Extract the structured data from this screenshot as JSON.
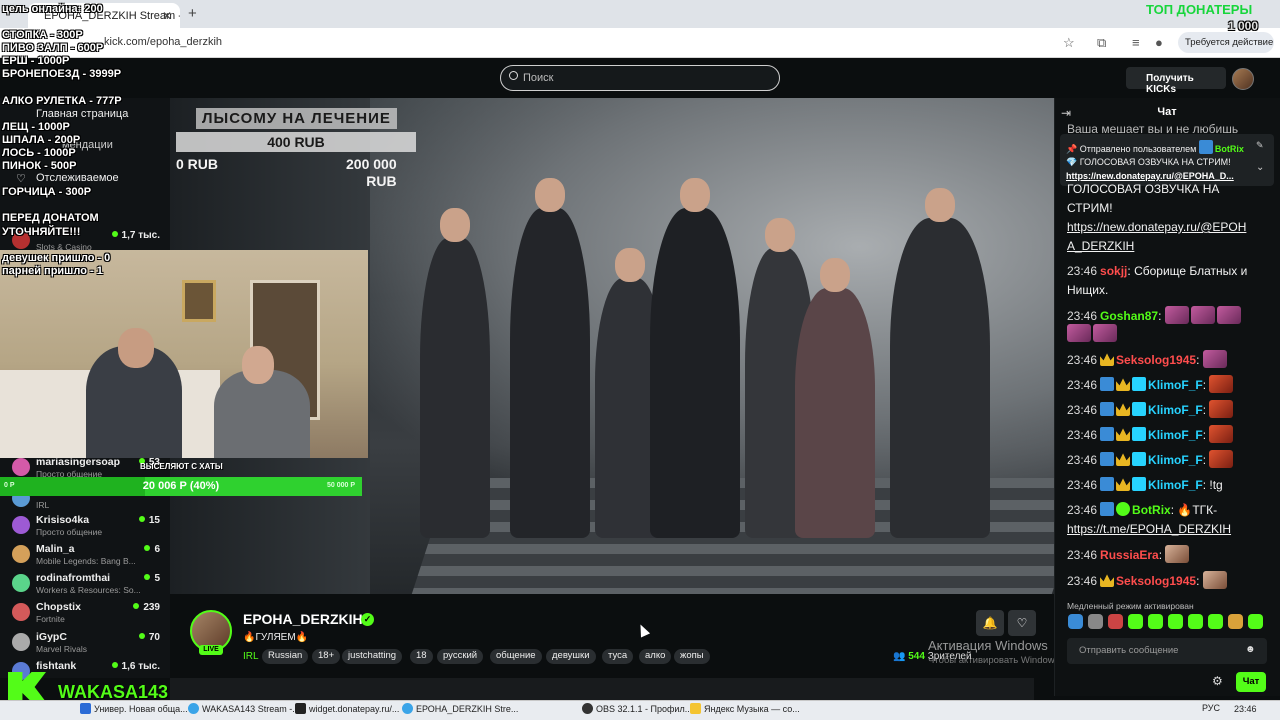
{
  "browser": {
    "tab_title": "ЕРОНА_DERZKIH Stream - ",
    "url": "kick.com/epoha_derzkih",
    "update_chip": "Требуется действие"
  },
  "header": {
    "search_placeholder": "Поиск",
    "get_kicks": "Получить KICKs"
  },
  "sidebar": {
    "home": "Главная страница",
    "following": "Отслеживаемое",
    "featured_visible": "мендации",
    "channels": [
      {
        "name": "",
        "category": "Slots & Casino",
        "viewers": "1,7 тыс.",
        "color": "#b53030"
      },
      {
        "name": "mariasingersoap",
        "category": "Просто общение",
        "viewers": "53",
        "color": "#d45aa8"
      },
      {
        "name": "",
        "category": "IRL",
        "viewers": "",
        "color": "#5a9ad4"
      },
      {
        "name": "Krisiso4ka",
        "category": "Просто общение",
        "viewers": "15",
        "color": "#9d5ad4"
      },
      {
        "name": "Malin_a",
        "category": "Mobile Legends: Bang B...",
        "viewers": "6",
        "color": "#d4a05a"
      },
      {
        "name": "rodinafromthai",
        "category": "Workers & Resources: So...",
        "viewers": "5",
        "color": "#5ad48a"
      },
      {
        "name": "Chopstix",
        "category": "Fortnite",
        "viewers": "239",
        "color": "#d45a5a"
      },
      {
        "name": "iGypC",
        "category": "Marvel Rivals",
        "viewers": "70",
        "color": "#aaaaaa"
      },
      {
        "name": "fishtank",
        "category": "",
        "viewers": "1,6 тыс.",
        "color": "#5a7ad4"
      }
    ]
  },
  "overlay": {
    "goal_online": "цель онлайна: 200",
    "price_list": [
      "СТОПКА - 300Р",
      "ПИВО ЗАЛП - 600Р",
      "ЕРШ - 1000Р",
      "БРОНЕПОЕЗД - 3999Р",
      "АЛКО РУЛЕТКА - 777Р",
      "ЛЕЩ - 1000Р",
      "ШПАЛА - 200Р",
      "ЛОСЬ - 1000Р",
      "ПИНОК - 500Р",
      "ГОРЧИЦА - 300Р"
    ],
    "warning_1": "ПЕРЕД ДОНАТОМ",
    "warning_2": "УТОЧНЯЙТЕ!!!",
    "girls": "девушек пришло - 0",
    "guys": "парней пришло - 1",
    "top_donors": "ТОП ДОНАТЕРЫ",
    "top_amount": "1 000",
    "green_bar_label": "ВЫСЕЛЯЮТ С ХАТЫ",
    "green_bar_value": "20 006 Р (40%)",
    "green_bar_progress": 0.4,
    "green_bar_left": "0 Р",
    "green_bar_right": "50 000 Р",
    "donate_title": "ЛЫСОМУ НА ЛЕЧЕНИЕ",
    "donate_current": "400 RUB",
    "donate_min": "0 RUB",
    "donate_max_1": "200 000",
    "donate_max_2": "RUB"
  },
  "stream": {
    "streamer": "ЕРОНА_DERZKIH",
    "live": "LIVE",
    "title": "🔥ГУЛЯЕМ🔥",
    "category": "IRL",
    "tags": [
      "Russian",
      "18+",
      "justchatting",
      "18",
      "русский",
      "общение",
      "девушки",
      "туса",
      "алко",
      "жопы"
    ],
    "viewers": "544",
    "viewers_label": "Зрителей",
    "activation_1": "Активация Windows",
    "activation_2": "Чтобы активировать Windows, перейдите в раздел \"Параметры\"."
  },
  "chat": {
    "title": "Чат",
    "top_cut": "Ваша мешает вы и не любишь",
    "pinned_by": "Отправлено пользователем",
    "pinned_user": "BotRix",
    "pinned_msg": "ГОЛОСОВАЯ ОЗВУЧКА НА СТРИМ!",
    "pinned_link": "https://new.donatepay.ru/@EPOHA_D...",
    "messages": [
      {
        "text": "ГОЛОСОВАЯ ОЗВУЧКА НА"
      },
      {
        "text": "СТРИМ!"
      },
      {
        "text": "https://new.donatepay.ru/@EPOH"
      },
      {
        "text": "A_DERZKIH"
      },
      {
        "time": "23:46",
        "user": "sokjj",
        "color": "#ff4d4d",
        "text": "Сборище Блатных и"
      },
      {
        "text": "Нищих."
      },
      {
        "time": "23:46",
        "user": "Goshan87",
        "color": "#53fc18",
        "text": ""
      },
      {
        "time": "23:46",
        "user": "Seksolog1945",
        "color": "#ff4d4d",
        "text": ""
      },
      {
        "time": "23:46",
        "user": "KlimoF_F",
        "color": "#27d3ff",
        "text": ""
      },
      {
        "time": "23:46",
        "user": "KlimoF_F",
        "color": "#27d3ff",
        "text": ""
      },
      {
        "time": "23:46",
        "user": "KlimoF_F",
        "color": "#27d3ff",
        "text": ""
      },
      {
        "time": "23:46",
        "user": "KlimoF_F",
        "color": "#27d3ff",
        "text": ""
      },
      {
        "time": "23:46",
        "user": "KlimoF_F",
        "color": "#27d3ff",
        "text": "!tg"
      },
      {
        "time": "23:46",
        "user": "BotRix",
        "color": "#53fc18",
        "text": "🔥ТГК-"
      },
      {
        "text": "https://t.me/EPOHA_DERZKIH"
      },
      {
        "time": "23:46",
        "user": "RussiaEra",
        "color": "#ff4d4d",
        "text": ""
      },
      {
        "time": "23:46",
        "user": "Seksolog1945",
        "color": "#ff4d4d",
        "text": ""
      }
    ],
    "slow_mode": "Медленный режим активирован",
    "input_placeholder": "Отправить сообщение",
    "send": "Чат"
  },
  "bottom": {
    "wakasa": "WAKASA143"
  },
  "taskbar": {
    "items": [
      "Универ. Новая обща...",
      "WAKASA143 Stream -...",
      "widget.donatepay.ru/...",
      "ЕРОНА_DERZKIH Stre...",
      "OBS 32.1.1 - Профил...",
      "Яндекс Музыка — со..."
    ],
    "lang": "РУС",
    "time": "23:46"
  }
}
